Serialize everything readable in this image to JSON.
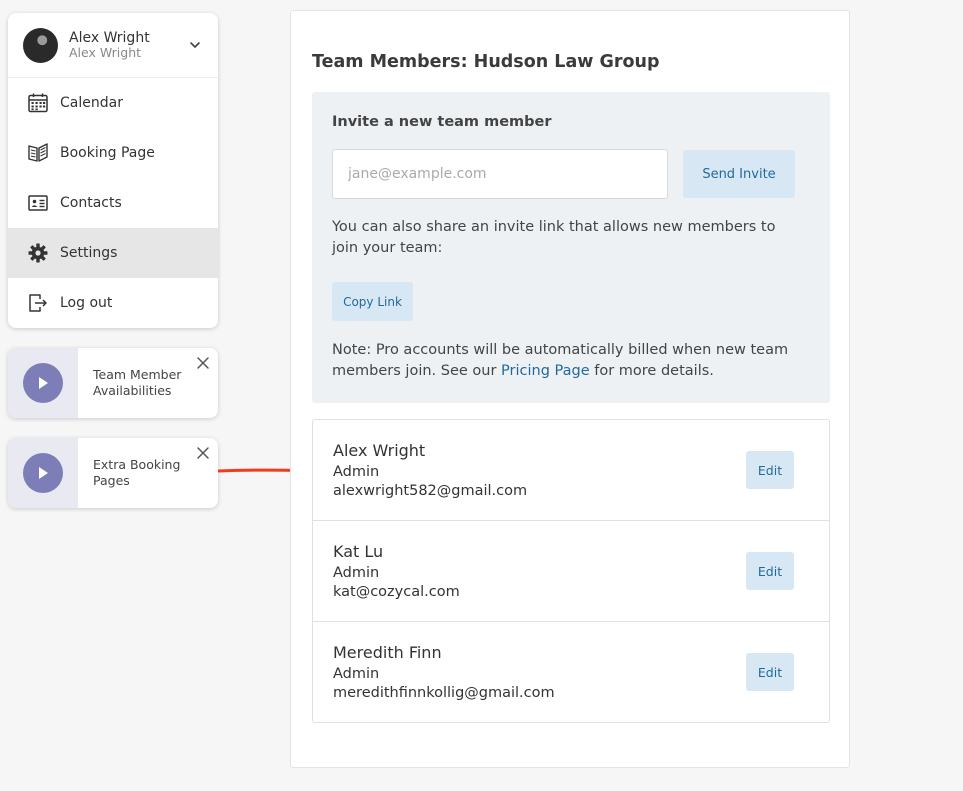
{
  "user": {
    "name": "Alex Wright",
    "subtitle": "Alex Wright"
  },
  "menu": {
    "items": [
      {
        "label": "Calendar",
        "icon": "calendar-icon"
      },
      {
        "label": "Booking Page",
        "icon": "book-icon"
      },
      {
        "label": "Contacts",
        "icon": "contact-card-icon"
      },
      {
        "label": "Settings",
        "icon": "gear-icon",
        "active": true
      },
      {
        "label": "Log out",
        "icon": "logout-icon"
      }
    ]
  },
  "tips": [
    {
      "label": "Team Member Availabilities"
    },
    {
      "label": "Extra Booking Pages"
    }
  ],
  "page": {
    "title": "Team Members: Hudson Law Group"
  },
  "invite": {
    "heading": "Invite a new team member",
    "email_placeholder": "jane@example.com",
    "send_label": "Send Invite",
    "share_text": "You can also share an invite link that allows new members to join your team:",
    "copy_label": "Copy Link",
    "note_prefix": "Note: Pro accounts will be automatically billed when new team members join. See our ",
    "note_link": "Pricing Page",
    "note_suffix": " for more details."
  },
  "members": [
    {
      "name": "Alex Wright",
      "role": "Admin",
      "email": "alexwright582@gmail.com",
      "edit_label": "Edit"
    },
    {
      "name": "Kat Lu",
      "role": "Admin",
      "email": "kat@cozycal.com",
      "edit_label": "Edit"
    },
    {
      "name": "Meredith Finn",
      "role": "Admin",
      "email": "meredithfinnkollig@gmail.com",
      "edit_label": "Edit"
    }
  ],
  "colors": {
    "accent": "#236a9a",
    "button_bg": "#d7e8f4",
    "invite_bg": "#edf1f4",
    "active_menu_bg": "#e6e6e6",
    "play_button": "#7d7eb8",
    "arrow": "#f23a1c"
  }
}
